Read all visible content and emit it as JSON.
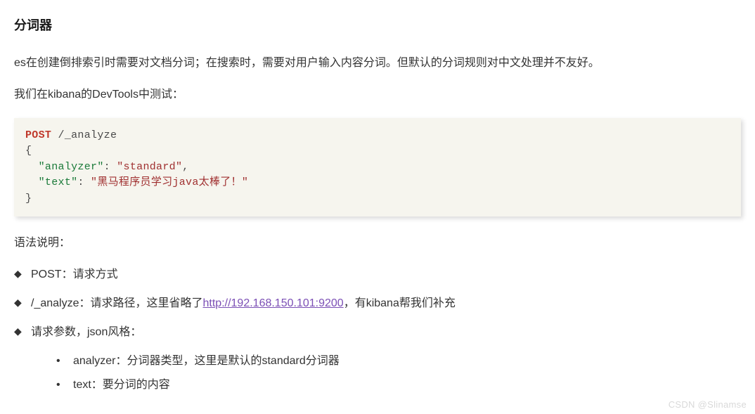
{
  "heading": "分词器",
  "paragraphs": {
    "p1": "es在创建倒排索引时需要对文档分词；在搜索时，需要对用户输入内容分词。但默认的分词规则对中文处理并不友好。",
    "p2": "我们在kibana的DevTools中测试："
  },
  "code": {
    "method": "POST",
    "path": "/_analyze",
    "brace_open": "{",
    "key1_quoted": "\"analyzer\"",
    "colon1": ": ",
    "val1_quoted": "\"standard\"",
    "comma": ",",
    "key2_quoted": "\"text\"",
    "colon2": ": ",
    "val2_quoted": "\"黑马程序员学习java太棒了！\"",
    "brace_close": "}"
  },
  "syntax_label": "语法说明：",
  "bullets": {
    "b1": "POST：请求方式",
    "b2_pre": "/_analyze：请求路径，这里省略了",
    "b2_link": "http://192.168.150.101:9200",
    "b2_post": "，有kibana帮我们补充",
    "b3": "请求参数，json风格："
  },
  "sub_bullets": {
    "s1": "analyzer：分词器类型，这里是默认的standard分词器",
    "s2": "text：要分词的内容"
  },
  "watermark": "CSDN @Slinamse"
}
